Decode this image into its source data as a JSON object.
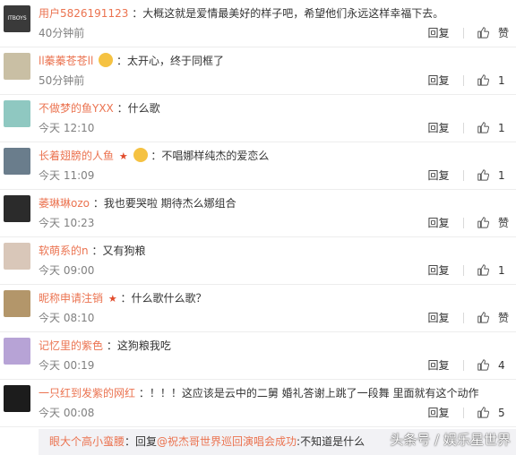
{
  "comments": [
    {
      "user": "用户5826191123",
      "badge": "",
      "emoji": false,
      "text": "：大概这就是爱情最美好的样子吧，希望他们永远这样幸福下去。",
      "time": "40分钟前",
      "reply": "回复",
      "likes": "赞",
      "avatar_color": "#3a3a3a",
      "avatar_text": "ITBOYS"
    },
    {
      "user": "ll蓁蓁苍苍ll",
      "badge": "",
      "emoji": true,
      "text": "：太开心，终于同框了",
      "time": "50分钟前",
      "reply": "回复",
      "likes": "1",
      "avatar_color": "#c9bfa4",
      "avatar_text": ""
    },
    {
      "user": "不做梦的鱼YXX",
      "badge": "",
      "emoji": false,
      "text": "：什么歌",
      "time": "今天 12:10",
      "reply": "回复",
      "likes": "1",
      "avatar_color": "#8fc8c1",
      "avatar_text": ""
    },
    {
      "user": "长着翅膀的人鱼",
      "badge": "★",
      "emoji": true,
      "text": "：不唱娜样纯杰的爱恋么",
      "time": "今天 11:09",
      "reply": "回复",
      "likes": "1",
      "avatar_color": "#6a7d8c",
      "avatar_text": ""
    },
    {
      "user": "萎琳琳ozo",
      "badge": "",
      "emoji": false,
      "text": "：我也要哭啦 期待杰么娜组合",
      "time": "今天 10:23",
      "reply": "回复",
      "likes": "赞",
      "avatar_color": "#2b2b2b",
      "avatar_text": ""
    },
    {
      "user": "软萌系的n",
      "badge": "",
      "emoji": false,
      "text": "：又有狗粮",
      "time": "今天 09:00",
      "reply": "回复",
      "likes": "1",
      "avatar_color": "#d9c7b9",
      "avatar_text": ""
    },
    {
      "user": "昵称申请注销",
      "badge": "★",
      "emoji": false,
      "text": "：什么歌什么歌？",
      "time": "今天 08:10",
      "reply": "回复",
      "likes": "赞",
      "avatar_color": "#b3966a",
      "avatar_text": ""
    },
    {
      "user": "记忆里的紫色",
      "badge": "",
      "emoji": false,
      "text": "：这狗粮我吃",
      "time": "今天 00:19",
      "reply": "回复",
      "likes": "4",
      "avatar_color": "#b7a3d6",
      "avatar_text": ""
    },
    {
      "user": "一只红到发紫的网红",
      "badge": "",
      "emoji": false,
      "text": "：！！！这应该是云中的二舅 婚礼答谢上跳了一段舞 里面就有这个动作",
      "time": "今天 00:08",
      "reply": "回复",
      "likes": "5",
      "avatar_color": "#1c1c1c",
      "avatar_text": ""
    }
  ],
  "subreply": {
    "user": "眼大个高小蛮腰",
    "prefix": "：回复",
    "mention": "@祝杰哥世界巡回演唱会成功",
    "text": ":不知道是什么"
  },
  "watermark": "头条号 / 娱乐星世界",
  "colors": {
    "username": "#eb7350",
    "badge": "#e14b2b",
    "time": "#808080"
  },
  "icons": {
    "like": "thumbs-up-icon"
  }
}
